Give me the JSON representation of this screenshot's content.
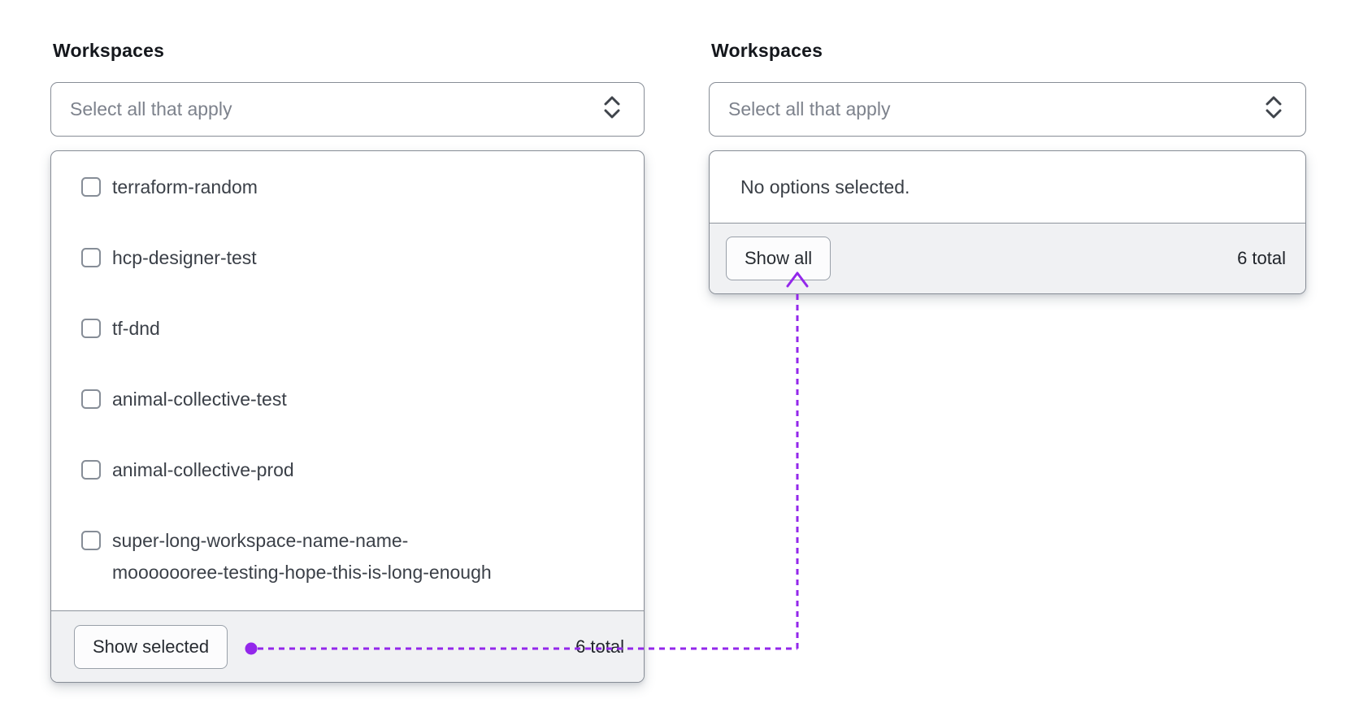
{
  "annotation": {
    "color": "#9327EB",
    "meaning": "toggle link between Show selected and Show all"
  },
  "left_widget": {
    "label": "Workspaces",
    "select": {
      "placeholder": "Select all that apply",
      "toggle_icon": "caret-updown-icon"
    },
    "options": [
      {
        "label": "terraform-random",
        "checked": false
      },
      {
        "label": "hcp-designer-test",
        "checked": false
      },
      {
        "label": "tf-dnd",
        "checked": false
      },
      {
        "label": "animal-collective-test",
        "checked": false
      },
      {
        "label": "animal-collective-prod",
        "checked": false
      },
      {
        "label": "super-long-workspace-name-name-mooooooree-testing-hope-this-is-long-enough",
        "label_line1": "super-long-workspace-name-name-",
        "label_line2": "mooooooree-testing-hope-this-is-long-enough",
        "checked": false
      }
    ],
    "footer": {
      "button_label": "Show selected",
      "total_label": "6 total"
    }
  },
  "right_widget": {
    "label": "Workspaces",
    "select": {
      "placeholder": "Select all that apply",
      "toggle_icon": "caret-updown-icon"
    },
    "body": {
      "empty_message": "No options selected."
    },
    "footer": {
      "button_label": "Show all",
      "total_label": "6 total"
    }
  }
}
